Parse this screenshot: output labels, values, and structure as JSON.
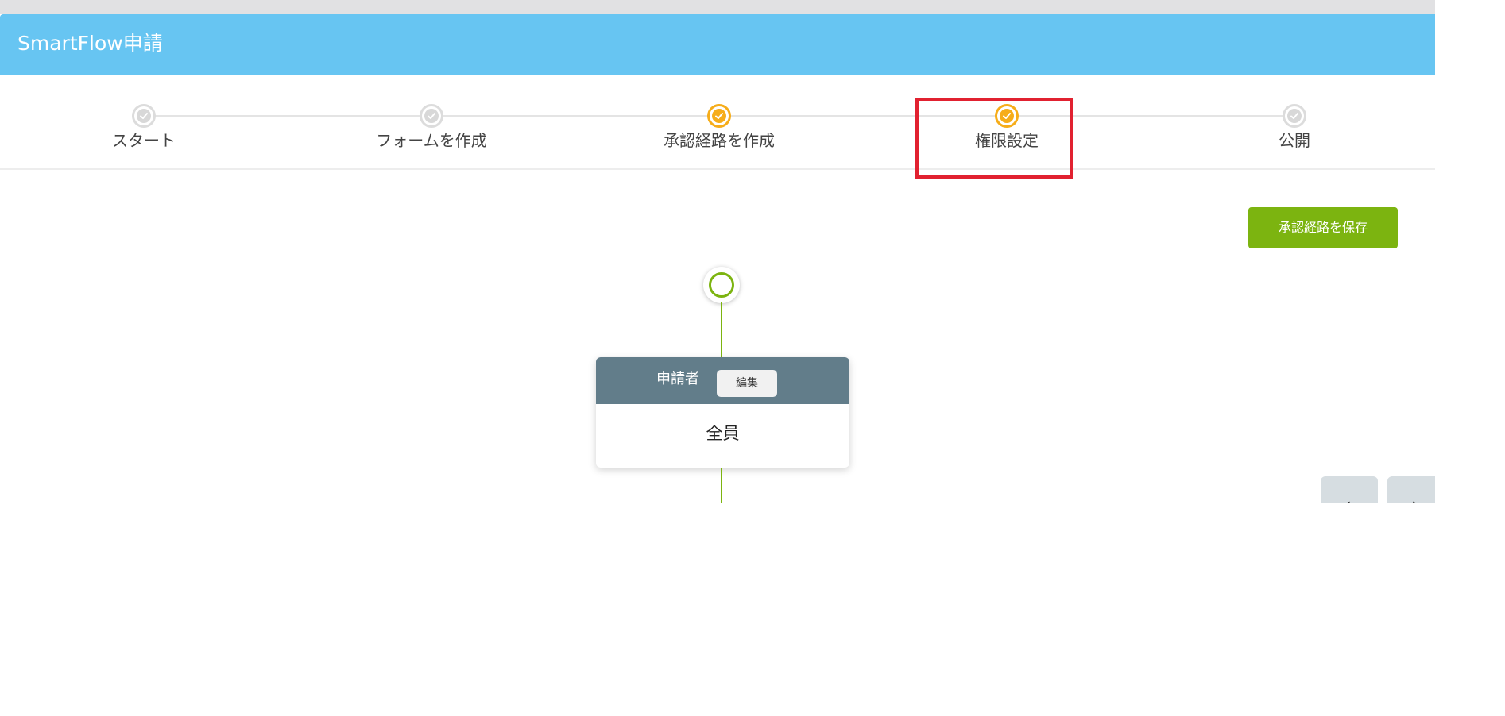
{
  "app": {
    "title": "SmartFlow申請"
  },
  "stepper": {
    "steps": [
      {
        "label": "スタート",
        "state": "done"
      },
      {
        "label": "フォームを作成",
        "state": "done"
      },
      {
        "label": "承認経路を作成",
        "state": "active"
      },
      {
        "label": "権限設定",
        "state": "active"
      },
      {
        "label": "公開",
        "state": "done"
      }
    ]
  },
  "toolbar": {
    "save_label": "承認経路を保存"
  },
  "flow": {
    "node": {
      "title": "申請者",
      "edit_label": "編集",
      "body": "全員"
    }
  },
  "pager": {
    "prev_icon": "chevron-left-icon",
    "next_icon": "chevron-right-icon",
    "prev_glyph": "‹",
    "next_glyph": "›"
  },
  "colors": {
    "header_bg": "#67c5f2",
    "accent_green": "#7cb410",
    "active_step": "#f6ad1a",
    "inactive_step": "#d8d8d8",
    "highlight": "#e12130",
    "card_header": "#627d8a"
  }
}
